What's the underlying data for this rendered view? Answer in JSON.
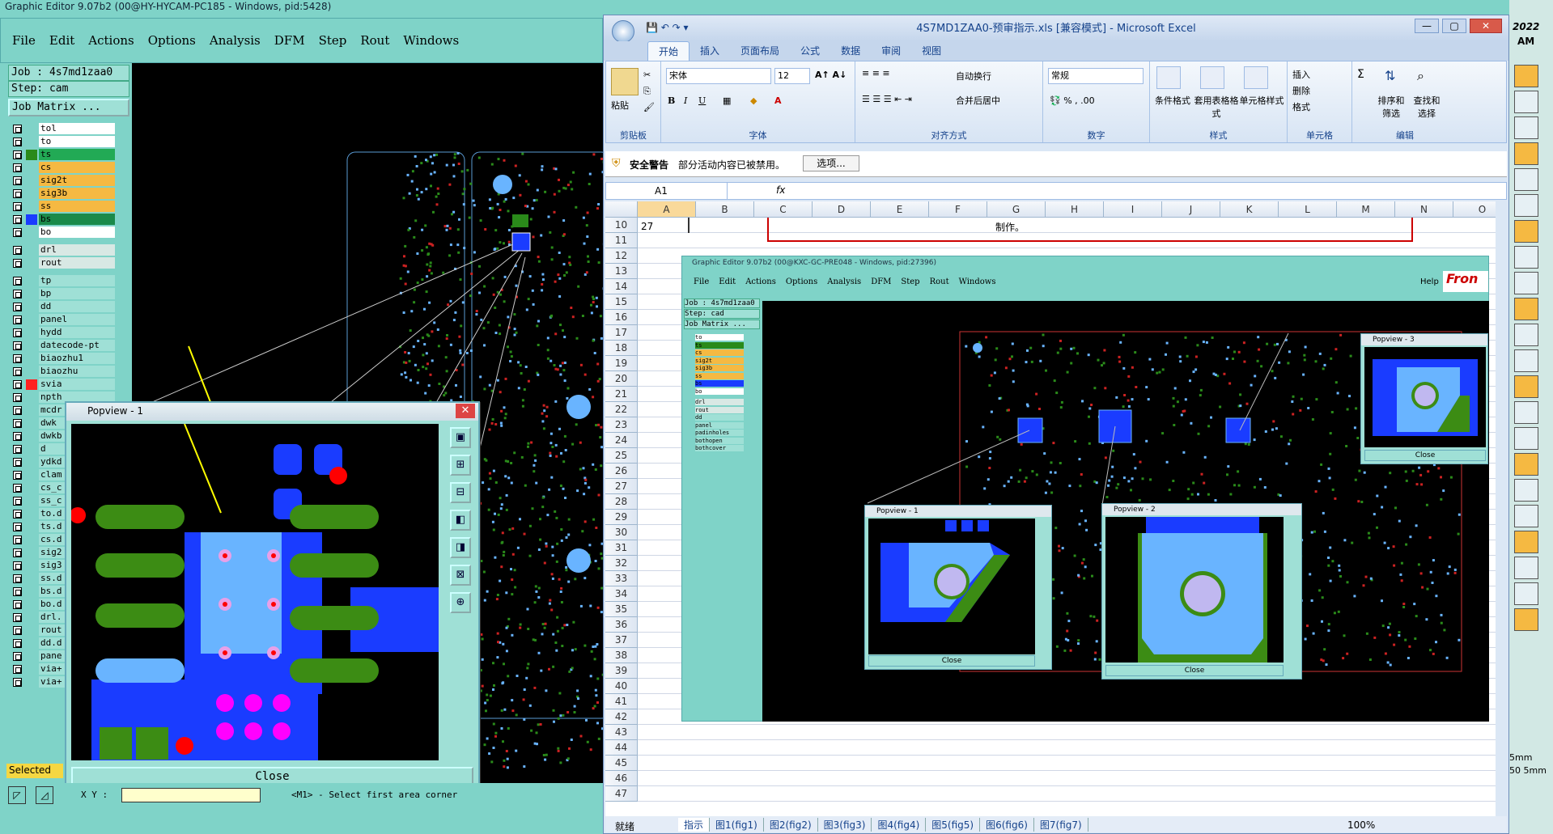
{
  "genesis": {
    "title": "Graphic Editor 9.07b2 (00@HY-HYCAM-PC185 - Windows, pid:5428)",
    "menu": [
      "File",
      "Edit",
      "Actions",
      "Options",
      "Analysis",
      "DFM",
      "Step",
      "Rout",
      "Windows"
    ],
    "job": "Job : 4s7md1zaa0",
    "step": "Step: cam",
    "job_matrix": "Job Matrix ...",
    "layers": [
      {
        "name": "tol",
        "color": "#ffffff"
      },
      {
        "name": "to",
        "color": "#ffffff"
      },
      {
        "name": "ts",
        "color": "#22aa55"
      },
      {
        "name": "cs",
        "color": "#f5b942"
      },
      {
        "name": "sig2t",
        "color": "#f5b942"
      },
      {
        "name": "sig3b",
        "color": "#f5b942"
      },
      {
        "name": "ss",
        "color": "#f5b942"
      },
      {
        "name": "bs",
        "color": "#1a8a4a"
      },
      {
        "name": "bo",
        "color": "#ffffff"
      },
      {
        "name": "drl",
        "color": "#d8e8e4"
      },
      {
        "name": "rout",
        "color": "#d8e8e4"
      },
      {
        "name": "tp",
        "color": "#9fe0d6"
      },
      {
        "name": "bp",
        "color": "#9fe0d6"
      },
      {
        "name": "dd",
        "color": "#9fe0d6"
      },
      {
        "name": "panel",
        "color": "#9fe0d6"
      },
      {
        "name": "hydd",
        "color": "#9fe0d6"
      },
      {
        "name": "datecode-pt",
        "color": "#9fe0d6"
      },
      {
        "name": "biaozhu1",
        "color": "#9fe0d6"
      },
      {
        "name": "biaozhu",
        "color": "#9fe0d6"
      },
      {
        "name": "svia",
        "color": "#9fe0d6"
      },
      {
        "name": "npth",
        "color": "#9fe0d6"
      },
      {
        "name": "mcdr",
        "color": "#9fe0d6"
      },
      {
        "name": "dwk",
        "color": "#9fe0d6"
      },
      {
        "name": "dwkb",
        "color": "#9fe0d6"
      },
      {
        "name": "d",
        "color": "#9fe0d6"
      },
      {
        "name": "ydkd",
        "color": "#9fe0d6"
      },
      {
        "name": "clam",
        "color": "#9fe0d6"
      },
      {
        "name": "cs_c",
        "color": "#9fe0d6"
      },
      {
        "name": "ss_c",
        "color": "#9fe0d6"
      },
      {
        "name": "to.d",
        "color": "#9fe0d6"
      },
      {
        "name": "ts.d",
        "color": "#9fe0d6"
      },
      {
        "name": "cs.d",
        "color": "#9fe0d6"
      },
      {
        "name": "sig2",
        "color": "#9fe0d6"
      },
      {
        "name": "sig3",
        "color": "#9fe0d6"
      },
      {
        "name": "ss.d",
        "color": "#9fe0d6"
      },
      {
        "name": "bs.d",
        "color": "#9fe0d6"
      },
      {
        "name": "bo.d",
        "color": "#9fe0d6"
      },
      {
        "name": "drl.",
        "color": "#9fe0d6"
      },
      {
        "name": "rout",
        "color": "#9fe0d6"
      },
      {
        "name": "dd.d",
        "color": "#9fe0d6"
      },
      {
        "name": "pane",
        "color": "#9fe0d6"
      },
      {
        "name": "via+",
        "color": "#9fe0d6"
      },
      {
        "name": "via+",
        "color": "#9fe0d6"
      }
    ],
    "selected_label": "Selected",
    "coord_label": "X Y :",
    "status_hint": "<M1> - Select first area corner"
  },
  "popview1": {
    "title": "Popview - 1",
    "close_label": "Close"
  },
  "excel": {
    "title": "4S7MD1ZAA0-预审指示.xls  [兼容模式] - Microsoft Excel",
    "tabs": [
      "开始",
      "插入",
      "页面布局",
      "公式",
      "数据",
      "审阅",
      "视图"
    ],
    "font_name": "宋体",
    "font_size": "12",
    "number_format": "常规",
    "groups": [
      "剪贴板",
      "字体",
      "对齐方式",
      "数字",
      "样式",
      "单元格",
      "编辑"
    ],
    "buttons": {
      "paste": "粘贴",
      "wrap": "自动换行",
      "merge": "合并后居中",
      "cond_format": "条件格式",
      "table_format": "套用表格格式",
      "cell_style": "单元格样式",
      "insert": "插入",
      "delete": "删除",
      "format": "格式",
      "sort": "排序和筛选",
      "find": "查找和选择"
    },
    "warning_title": "安全警告",
    "warning_text": "部分活动内容已被禁用。",
    "options_btn": "选项...",
    "name_box": "A1",
    "fx": "fx",
    "columns": [
      "A",
      "B",
      "C",
      "D",
      "E",
      "F",
      "G",
      "H",
      "I",
      "J",
      "K",
      "L",
      "M",
      "N",
      "O"
    ],
    "rows": [
      "10",
      "11",
      "12",
      "13",
      "14",
      "15",
      "16",
      "17",
      "18",
      "19",
      "20",
      "21",
      "22",
      "23",
      "24",
      "25",
      "26",
      "27",
      "28",
      "29",
      "30",
      "31",
      "32",
      "33",
      "34",
      "35",
      "36",
      "37",
      "38",
      "39",
      "40",
      "41",
      "42",
      "43",
      "44",
      "45",
      "46",
      "47"
    ],
    "cell_a10": "27",
    "cell_merged_text": "制作。",
    "sheet_tabs": [
      "指示",
      "图1(fig1)",
      "图2(fig2)",
      "图3(fig3)",
      "图4(fig4)",
      "图5(fig5)",
      "图6(fig6)",
      "图7(fig7)"
    ],
    "status": "就绪",
    "zoom": "100%"
  },
  "embedded": {
    "title": "Graphic Editor 9.07b2 (00@KXC-GC-PRE048 - Windows, pid:27396)",
    "menu": [
      "File",
      "Edit",
      "Actions",
      "Options",
      "Analysis",
      "DFM",
      "Step",
      "Rout",
      "Windows"
    ],
    "help": "Help",
    "brand": "Fron",
    "job": "Job : 4s7md1zaa0",
    "step": "Step: cad",
    "job_matrix": "Job Matrix ...",
    "layers": [
      "to",
      "ts",
      "cs",
      "sig2t",
      "sig3b",
      "ss",
      "bs",
      "bo",
      "drl",
      "rout",
      "dd",
      "panel",
      "padinholes",
      "bothopen",
      "bothcover"
    ],
    "pop_titles": [
      "Popview - 1",
      "Popview - 2",
      "Popview - 3"
    ],
    "close": "Close"
  },
  "right_strip": {
    "clock": "AM",
    "year": "2022",
    "vals": [
      "5mm",
      "50 5mm"
    ]
  }
}
